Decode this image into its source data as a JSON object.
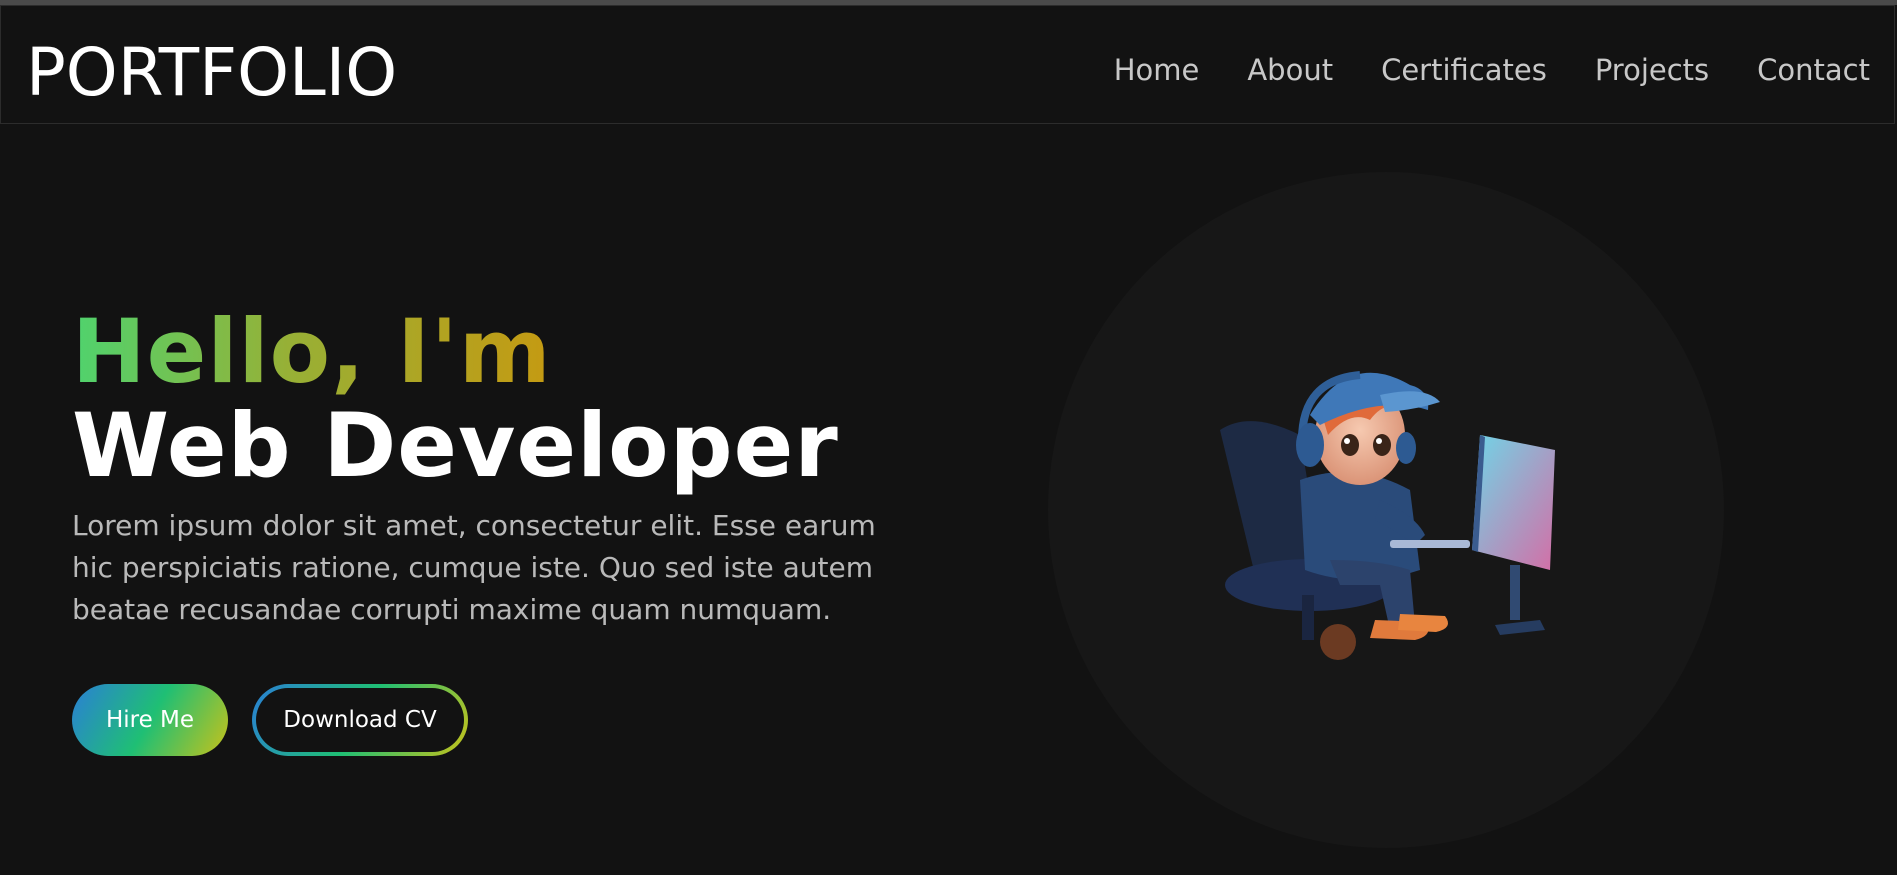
{
  "header": {
    "logo": "PORTFOLIO",
    "nav": [
      "Home",
      "About",
      "Certificates",
      "Projects",
      "Contact"
    ]
  },
  "hero": {
    "greeting": "Hello, I'm",
    "role": "Web Developer",
    "description": "Lorem ipsum dolor sit amet, consectetur elit. Esse earum hic perspiciatis ratione, cumque iste. Quo sed iste autem beatae recusandae corrupti maxime quam numquam.",
    "hire_button": "Hire Me",
    "cv_button": "Download CV"
  },
  "colors": {
    "background": "#121212",
    "gradient_start": "#2a7fd6",
    "gradient_mid": "#1fbf74",
    "gradient_end": "#c8c21a",
    "greeting_green": "#4fd36e",
    "greeting_gold": "#c59a12"
  },
  "illustration": {
    "icon": "developer-avatar-illustration"
  }
}
